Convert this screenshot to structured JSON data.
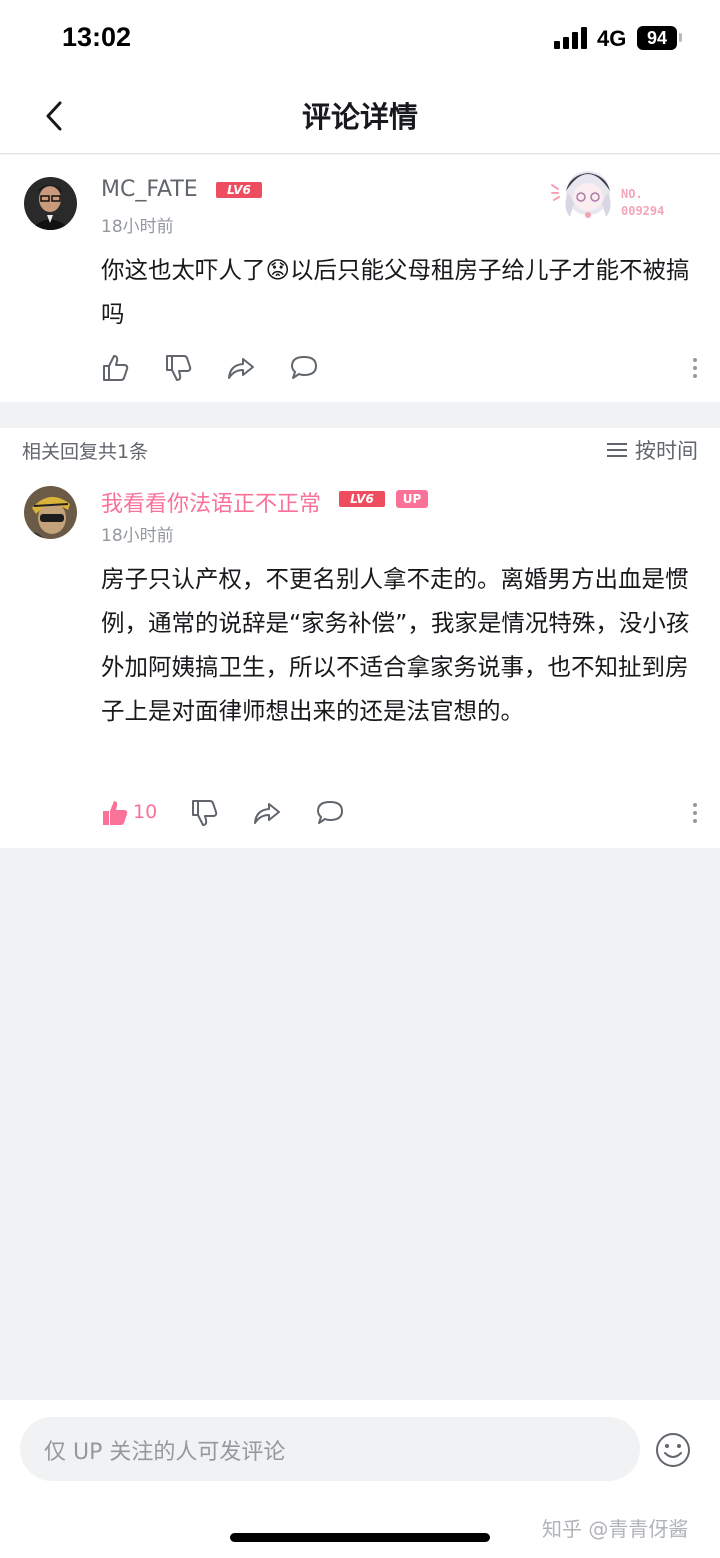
{
  "status_bar": {
    "time": "13:02",
    "network": "4G",
    "battery": "94"
  },
  "header": {
    "title": "评论详情"
  },
  "main_comment": {
    "username": "MC_FATE",
    "level": "LV6",
    "time": "18小时前",
    "text": "你这也太吓人了😟以后只能父母租房子给儿子才能不被搞吗",
    "fan_badge_label": "NO.",
    "fan_badge_number": "009294"
  },
  "replies_header": {
    "count_label": "相关回复共1条",
    "sort_label": "按时间"
  },
  "reply": {
    "username": "我看看你法语正不正常",
    "level": "LV6",
    "up_badge": "UP",
    "time": "18小时前",
    "text": "房子只认产权，不更名别人拿不走的。离婚男方出血是惯例，通常的说辞是“家务补偿”，我家是情况特殊，没小孩外加阿姨搞卫生，所以不适合拿家务说事，也不知扯到房子上是对面律师想出来的还是法官想的。",
    "like_count": "10"
  },
  "comment_bar": {
    "placeholder": "仅 UP 关注的人可发评论"
  },
  "watermark": "知乎 @青青伢酱",
  "colors": {
    "accent_pink": "#fb7299",
    "level_red": "#ee4d5f",
    "muted": "#9499a0",
    "background": "#f1f2f3"
  }
}
